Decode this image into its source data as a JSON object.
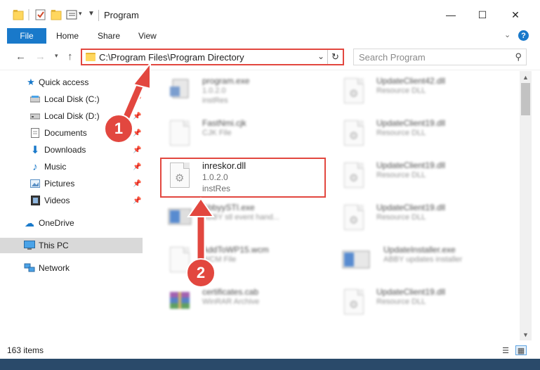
{
  "window": {
    "title": "Program",
    "controls": {
      "minimize": "—",
      "maximize": "☐",
      "close": "✕"
    }
  },
  "ribbon": {
    "tabs": [
      "File",
      "Home",
      "Share",
      "View"
    ],
    "help": "?"
  },
  "address": {
    "path": "C:\\Program Files\\Program Directory",
    "search_placeholder": "Search Program"
  },
  "sidebar": {
    "items": [
      {
        "label": "Quick access",
        "icon": "star-icon"
      },
      {
        "label": "Local Disk (C:)",
        "icon": "drive-icon",
        "pinned": true
      },
      {
        "label": "Local Disk (D:)",
        "icon": "drive-icon",
        "pinned": true
      },
      {
        "label": "Documents",
        "icon": "documents-icon",
        "pinned": true
      },
      {
        "label": "Downloads",
        "icon": "download-icon",
        "pinned": true
      },
      {
        "label": "Music",
        "icon": "music-icon",
        "pinned": true
      },
      {
        "label": "Pictures",
        "icon": "pictures-icon",
        "pinned": true
      },
      {
        "label": "Videos",
        "icon": "videos-icon",
        "pinned": true
      },
      {
        "label": "OneDrive",
        "icon": "cloud-icon"
      },
      {
        "label": "This PC",
        "icon": "computer-icon",
        "selected": true
      },
      {
        "label": "Network",
        "icon": "network-icon"
      }
    ]
  },
  "files": {
    "left_column": [
      {
        "name": "program.exe",
        "line1": "1.0.2.0",
        "line2": "instRes",
        "icon": "exe-icon"
      },
      {
        "name": "FastNmi.cjk",
        "line1": "CJK File",
        "icon": "blank-file-icon"
      },
      {
        "name": "inreskor.dll",
        "line1": "1.0.2.0",
        "line2": "instRes",
        "icon": "dll-gear-icon",
        "highlighted": true
      },
      {
        "name": "AbbyySTI.exe",
        "line1": "ABBY stl event hand...",
        "icon": "exe-icon"
      },
      {
        "name": "AddToWP15.wcm",
        "line1": "WCM File",
        "icon": "blank-file-icon"
      },
      {
        "name": "certificates.cab",
        "line1": "WinRAR Archive",
        "icon": "archive-icon"
      }
    ],
    "right_column": [
      {
        "name": "UpdateClient42.dll",
        "line1": "Resource DLL",
        "icon": "dll-gear-icon"
      },
      {
        "name": "UpdateClient19.dll",
        "line1": "Resource DLL",
        "icon": "dll-gear-icon"
      },
      {
        "name": "UpdateClient19.dll",
        "line1": "Resource DLL",
        "icon": "dll-gear-icon"
      },
      {
        "name": "UpdateClient19.dll",
        "line1": "Resource DLL",
        "icon": "dll-gear-icon"
      },
      {
        "name": "UpdateInstaller.exe",
        "line1": "ABBY updates installer",
        "icon": "installer-icon"
      },
      {
        "name": "UpdateClient19.dll",
        "line1": "Resource DLL",
        "icon": "dll-gear-icon"
      }
    ]
  },
  "status": {
    "item_count": "163 items"
  },
  "annotations": {
    "step1": "1",
    "step2": "2",
    "color": "#e2473f"
  },
  "colors": {
    "accent": "#1979ca",
    "highlight": "#e2473f",
    "selected_nav": "#d9d9d9"
  }
}
